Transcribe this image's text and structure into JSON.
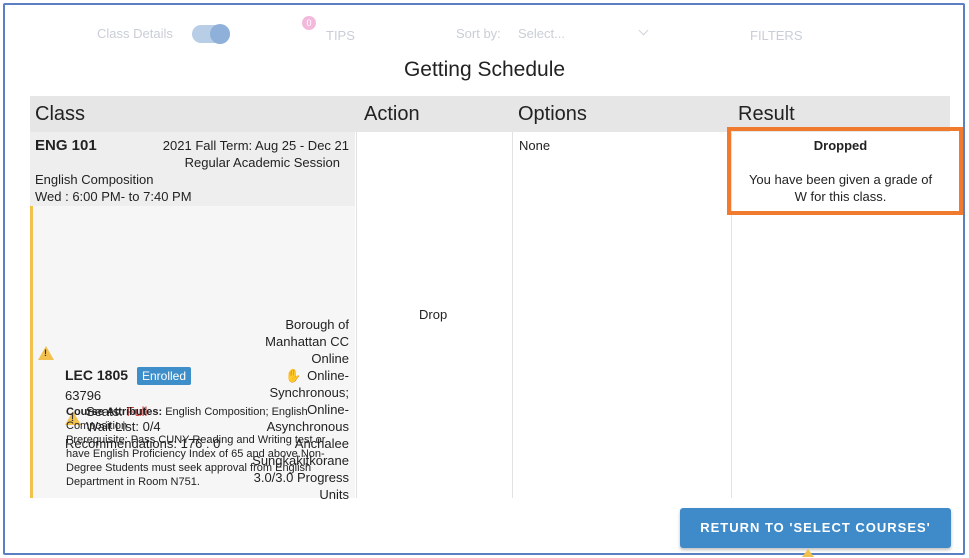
{
  "toolbar": {
    "class_details_label": "Class Details",
    "tips_count": "0",
    "tips_label": "TIPS",
    "sort_label": "Sort by:",
    "sort_placeholder": "Select...",
    "filters_label": "FILTERS"
  },
  "page_title": "Getting Schedule",
  "table": {
    "headers": [
      "Class",
      "Action",
      "Options",
      "Result"
    ],
    "course": {
      "code": "ENG 101",
      "term": "2021 Fall Term: Aug 25 - Dec 21",
      "session": "Regular Academic Session",
      "name": "English Composition",
      "meeting": "Wed : 6:00 PM- to 7:40 PM"
    },
    "section": {
      "id": "LEC 1805",
      "status": "Enrolled",
      "class_number": "63796",
      "seats_label": "Seats: ",
      "seats_value": "Full",
      "wait_list": "Wait List: 0/4",
      "recommendations": "Recommendations: 176 : 0",
      "location_lines": [
        "Borough of",
        "Manhattan CC",
        "Online",
        "Online-",
        "Synchronous;",
        "Online-",
        "Asynchronous",
        "Anchalee",
        "Sungkakitkorane",
        "3.0/3.0 Progress",
        "Units"
      ],
      "attributes_label": "Course Attributes:",
      "attributes_value": " English Composition; English",
      "attributes_cont": "Composition",
      "prereq_lines": [
        "Prerequisite: Pass CUNY Reading and Writing test or",
        "have English Proficiency Index of 65 and above.Non-",
        "Degree Students must seek approval from English",
        "Department in Room N751."
      ]
    },
    "action": "Drop",
    "options": "None",
    "result_title": "Dropped",
    "result_msg_1": "You have been given a grade of",
    "result_msg_2": "W for this class."
  },
  "return_button": "RETURN TO 'SELECT COURSES'",
  "colors": {
    "accent": "#3f8bc9",
    "highlight": "#f07a2e",
    "warning": "#f2c14e",
    "seats_full": "#d32f2f"
  }
}
